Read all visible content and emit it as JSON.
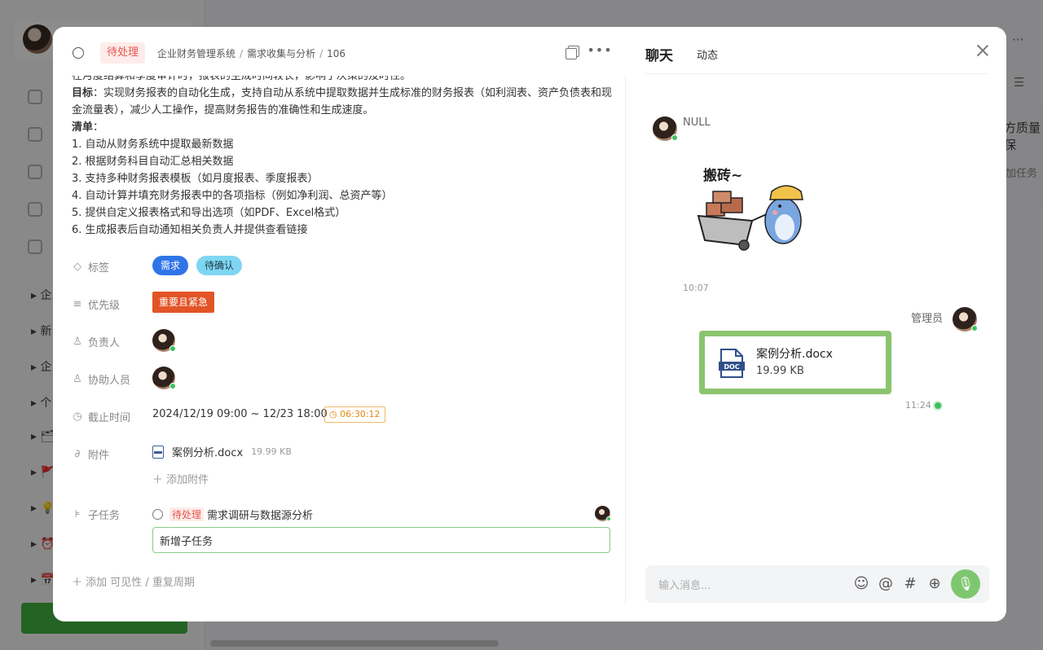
{
  "background": {
    "tree_items": [
      "企",
      "新",
      "企",
      "个",
      "",
      "",
      "",
      ""
    ],
    "right_texts": [
      "方质量保",
      "加任务"
    ]
  },
  "task": {
    "status": "待处理",
    "breadcrumb": [
      "企业财务管理系统",
      "需求收集与分析",
      "106"
    ],
    "description": {
      "line0": "在月度结算和季度审计时，报表的生成时间较长，影响了决策的及时性。",
      "goal_label": "目标",
      "goal_text": "：实现财务报表的自动化生成，支持自动从系统中提取数据并生成标准的财务报表（如利润表、资产负债表和现金流量表），减少人工操作，提高财务报告的准确性和生成速度。",
      "list_label": "清单",
      "list_colon": "：",
      "items": [
        "1. 自动从财务系统中提取最新数据",
        "2. 根据财务科目自动汇总相关数据",
        "3. 支持多种财务报表模板（如月度报表、季度报表）",
        "4. 自动计算并填充财务报表中的各项指标（例如净利润、总资产等）",
        "5. 提供自定义报表格式和导出选项（如PDF、Excel格式）",
        "6. 生成报表后自动通知相关负责人并提供查看链接"
      ]
    },
    "labels": {
      "tags": "标签",
      "priority": "优先级",
      "owner": "负责人",
      "assistants": "协助人员",
      "deadline": "截止时间",
      "attachments": "附件",
      "subtasks": "子任务"
    },
    "tags": [
      "需求",
      "待确认"
    ],
    "priority": "重要且紧急",
    "deadline": "2024/12/19 09:00 ~ 12/23 18:00",
    "countdown": "06:30:12",
    "attachment": {
      "name": "案例分析.docx",
      "size": "19.99 KB"
    },
    "add_attachment": "添加附件",
    "subtask": {
      "status": "待处理",
      "title": "需求调研与数据源分析"
    },
    "subtask_input_value": "新增子任务",
    "add_more": "添加 可见性 / 重复周期"
  },
  "chat": {
    "tab_chat": "聊天",
    "tab_activity": "动态",
    "messages": [
      {
        "sender": "NULL",
        "sticker_text": "搬砖~",
        "time": "10:07"
      },
      {
        "sender": "管理员",
        "file_name": "案例分析.docx",
        "file_size": "19.99 KB",
        "time": "11:24"
      }
    ],
    "input_placeholder": "输入消息..."
  }
}
